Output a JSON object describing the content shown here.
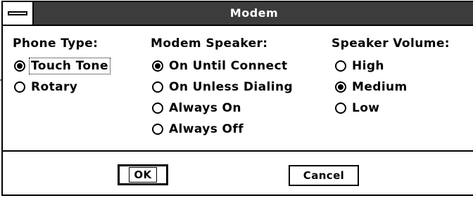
{
  "window": {
    "title": "Modem"
  },
  "phone_type": {
    "label": "Phone Type:",
    "options": [
      {
        "label": "Touch Tone",
        "checked": true
      },
      {
        "label": "Rotary",
        "checked": false
      }
    ]
  },
  "modem_speaker": {
    "label": "Modem Speaker:",
    "options": [
      {
        "label": "On Until Connect",
        "checked": true
      },
      {
        "label": "On Unless Dialing",
        "checked": false
      },
      {
        "label": "Always On",
        "checked": false
      },
      {
        "label": "Always Off",
        "checked": false
      }
    ]
  },
  "speaker_volume": {
    "label": "Speaker Volume:",
    "options": [
      {
        "label": "High",
        "checked": false
      },
      {
        "label": "Medium",
        "checked": true
      },
      {
        "label": "Low",
        "checked": false
      }
    ]
  },
  "buttons": {
    "ok_label": "OK",
    "cancel_label": "Cancel"
  }
}
